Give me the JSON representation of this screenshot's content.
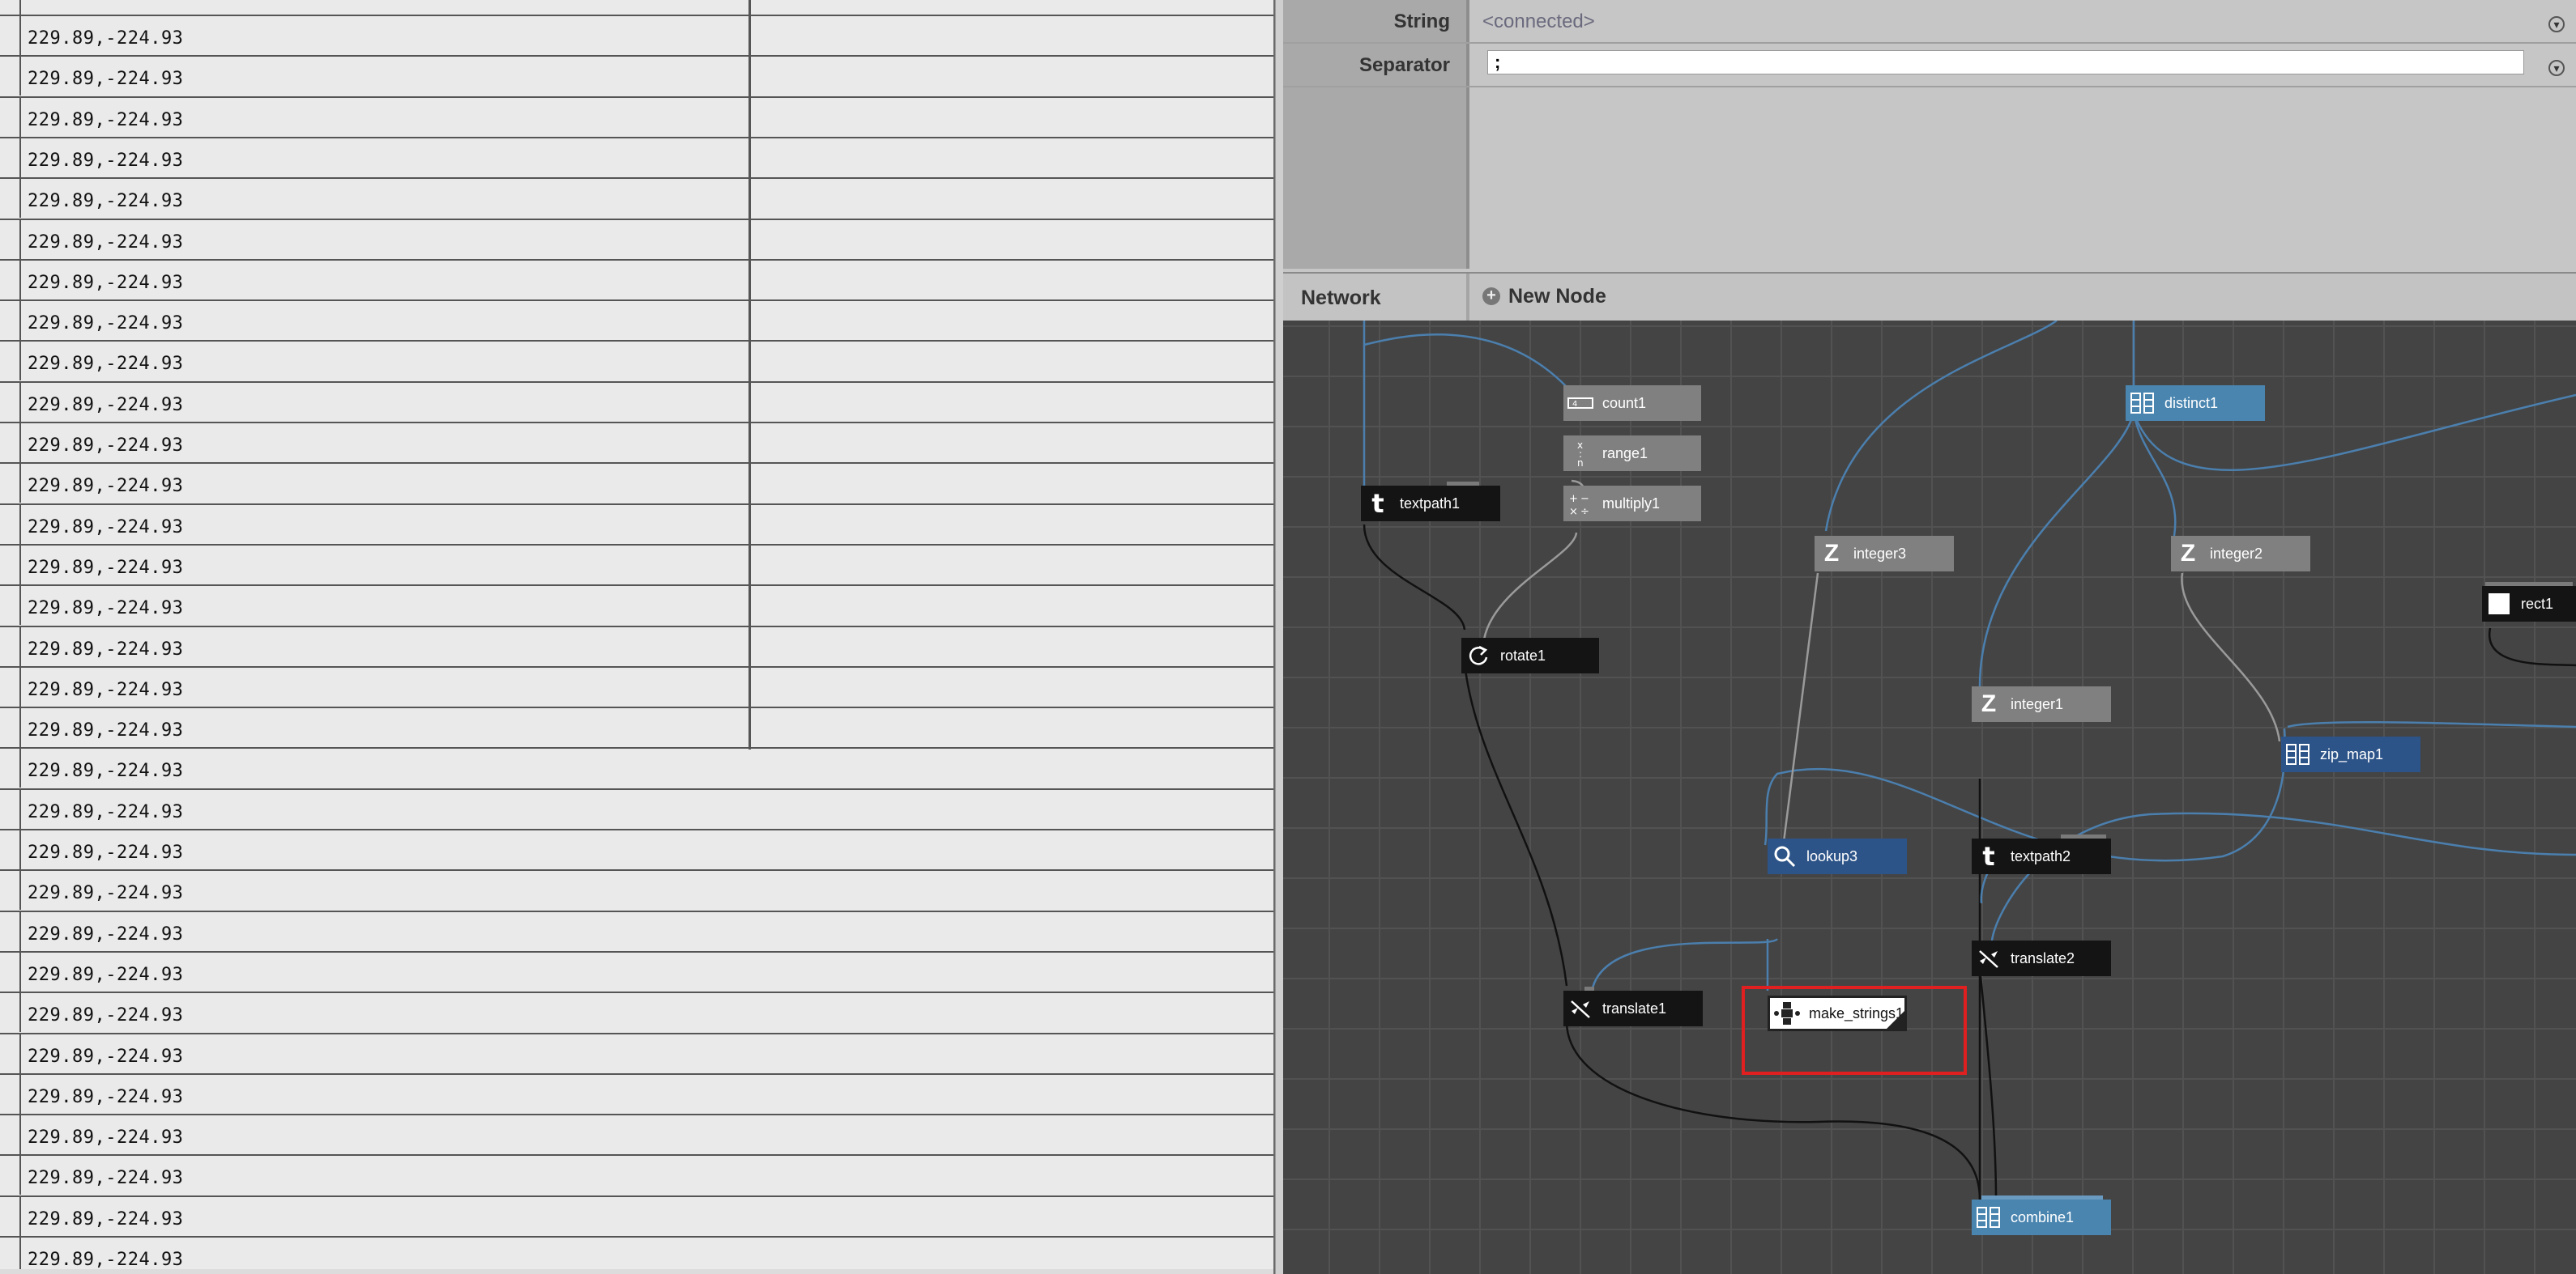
{
  "data_table": {
    "rows": [
      "229.89,-224.93",
      "229.89,-224.93",
      "229.89,-224.93",
      "229.89,-224.93",
      "229.89,-224.93",
      "229.89,-224.93",
      "229.89,-224.93",
      "229.89,-224.93",
      "229.89,-224.93",
      "229.89,-224.93",
      "229.89,-224.93",
      "229.89,-224.93",
      "229.89,-224.93",
      "229.89,-224.93",
      "229.89,-224.93",
      "229.89,-224.93",
      "229.89,-224.93",
      "229.89,-224.93",
      "229.89,-224.93",
      "229.89,-224.93",
      "229.89,-224.93",
      "229.89,-224.93",
      "229.89,-224.93",
      "229.89,-224.93",
      "229.89,-224.93",
      "229.89,-224.93",
      "229.89,-224.93",
      "229.89,-224.93",
      "229.89,-224.93",
      "229.89,-224.93",
      "229.89,-224.93"
    ]
  },
  "parameters": {
    "string_label": "String",
    "string_value": "<connected>",
    "separator_label": "Separator",
    "separator_value": ";"
  },
  "network": {
    "title": "Network",
    "new_node_label": "New Node",
    "nodes": [
      {
        "id": "count1",
        "label": "count1",
        "style": "gray",
        "icon": "count-icon"
      },
      {
        "id": "range1",
        "label": "range1",
        "style": "gray",
        "icon": "range-icon"
      },
      {
        "id": "multiply1",
        "label": "multiply1",
        "style": "gray",
        "icon": "multiply-icon"
      },
      {
        "id": "textpath1",
        "label": "textpath1",
        "style": "black",
        "icon": "text-t-icon"
      },
      {
        "id": "rotate1",
        "label": "rotate1",
        "style": "black",
        "icon": "rotate-icon"
      },
      {
        "id": "integer3",
        "label": "integer3",
        "style": "gray",
        "icon": "integer-z-icon"
      },
      {
        "id": "distinct1",
        "label": "distinct1",
        "style": "blue",
        "icon": "list-icon"
      },
      {
        "id": "integer2",
        "label": "integer2",
        "style": "gray",
        "icon": "integer-z-icon"
      },
      {
        "id": "rect1",
        "label": "rect1",
        "style": "black",
        "icon": "rect-icon"
      },
      {
        "id": "integer1",
        "label": "integer1",
        "style": "gray",
        "icon": "integer-z-icon"
      },
      {
        "id": "zip_map1",
        "label": "zip_map1",
        "style": "navy",
        "icon": "list-icon"
      },
      {
        "id": "lookup3",
        "label": "lookup3",
        "style": "navy",
        "icon": "search-icon"
      },
      {
        "id": "textpath2",
        "label": "textpath2",
        "style": "black",
        "icon": "text-t-icon"
      },
      {
        "id": "translate2",
        "label": "translate2",
        "style": "black",
        "icon": "translate-icon"
      },
      {
        "id": "translate1",
        "label": "translate1",
        "style": "black",
        "icon": "translate-icon"
      },
      {
        "id": "make_strings1",
        "label": "make_strings1",
        "style": "white",
        "icon": "make-strings-icon"
      },
      {
        "id": "combine1",
        "label": "combine1",
        "style": "blue",
        "icon": "list-icon"
      }
    ],
    "selected_node": "make_strings1"
  }
}
